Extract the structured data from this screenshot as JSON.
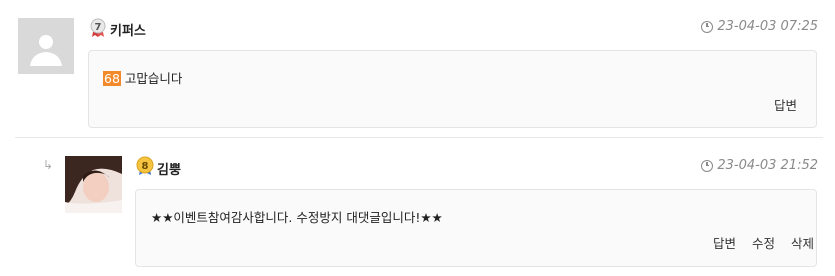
{
  "comments": [
    {
      "username": "키퍼스",
      "level": "7",
      "timestamp": "23-04-03 07:25",
      "level_number": "68",
      "text": "고맙습니다",
      "actions": [
        "답변"
      ]
    },
    {
      "username": "김뿡",
      "level": "8",
      "timestamp": "23-04-03 21:52",
      "text": "★★이벤트참여감사합니다. 수정방지 대댓글입니다!★★",
      "actions": [
        "답변",
        "수정",
        "삭제"
      ]
    }
  ],
  "icons": {
    "reply_indicator": "reply-arrow-icon",
    "clock": "clock-icon"
  }
}
